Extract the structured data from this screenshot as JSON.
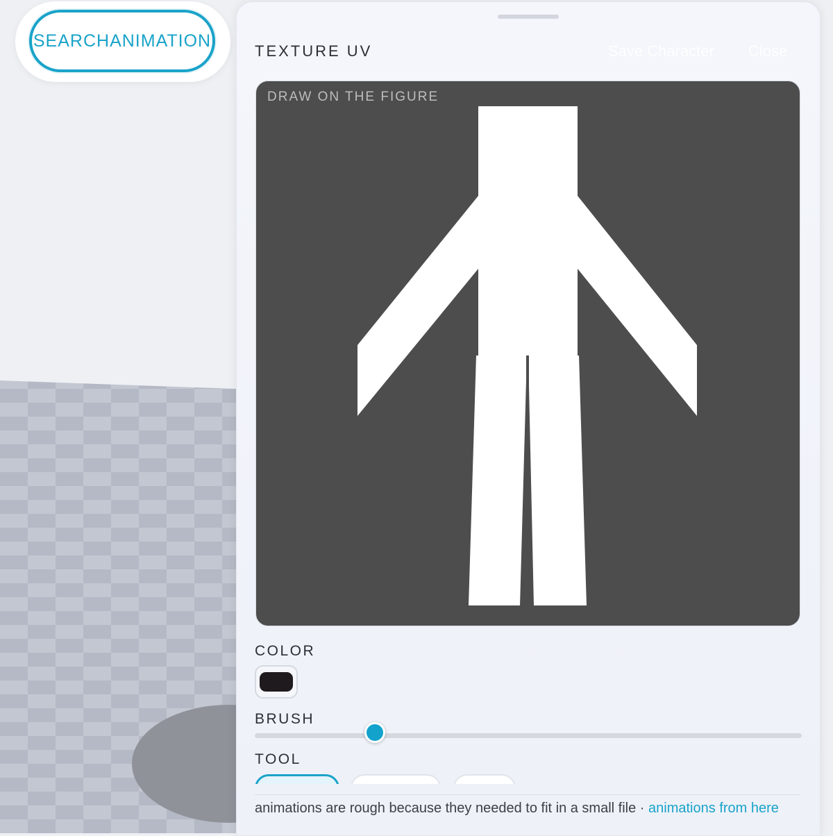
{
  "search": {
    "label": "SEARCH ANIMATION"
  },
  "panel": {
    "title": "TEXTURE UV",
    "save_label": "Save Character",
    "close_label": "Close"
  },
  "canvas": {
    "label": "DRAW ON THE FIGURE"
  },
  "color": {
    "label": "COLOR",
    "value": "#1f1a1d"
  },
  "brush": {
    "label": "BRUSH",
    "value_fraction": 0.22
  },
  "tool": {
    "label": "TOOL"
  },
  "footer": {
    "text": "animations are rough because they needed to fit in a small file · ",
    "link": "animations from here"
  },
  "colors": {
    "accent": "#1aa3c9",
    "canvas_bg": "#4d4d4d",
    "figure": "#ffffff"
  }
}
